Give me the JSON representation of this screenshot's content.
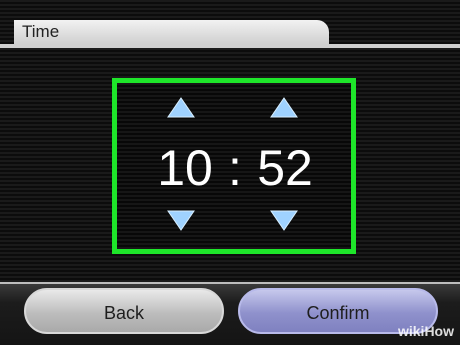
{
  "header": {
    "title": "Time"
  },
  "time": {
    "hours": "10",
    "separator": ":",
    "minutes": "52"
  },
  "icons": {
    "hour_up": "chevron-up-icon",
    "minute_up": "chevron-up-icon",
    "hour_down": "chevron-down-icon",
    "minute_down": "chevron-down-icon"
  },
  "buttons": {
    "back_label": "Back",
    "confirm_label": "Confirm"
  },
  "watermark": "wikiHow",
  "colors": {
    "frame": "#1ee62a",
    "arrow": "#9fd2ff",
    "confirm": "#8f91cc",
    "back": "#bdbdbd"
  }
}
